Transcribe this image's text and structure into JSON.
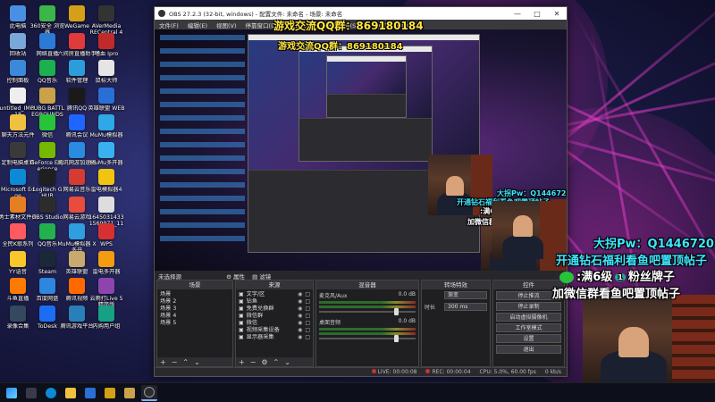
{
  "desktop": {
    "icons": [
      {
        "label": "此电脑",
        "color": "#4a90e2",
        "icon": "computer-icon"
      },
      {
        "label": "360安全\n浏览器",
        "color": "#3cb54a",
        "icon": "browser-icon"
      },
      {
        "label": "WeGame",
        "color": "#d4a017",
        "icon": "wegame-icon"
      },
      {
        "label": "AVerMedia\nRECentral 4",
        "color": "#333333",
        "icon": "avermedia-icon"
      },
      {
        "label": "回收站",
        "color": "#7aa7d9",
        "icon": "recycle-bin-icon"
      },
      {
        "label": "网络直播",
        "color": "#2b7bd6",
        "icon": "network-icon"
      },
      {
        "label": "六间房直播助手",
        "color": "#e03a3a",
        "icon": "liujianfang-icon"
      },
      {
        "label": "嗜血 Ipro",
        "color": "#c02a2a",
        "icon": "app-icon"
      },
      {
        "label": "控制面板",
        "color": "#3b8ad9",
        "icon": "control-panel-icon"
      },
      {
        "label": "QQ音乐",
        "color": "#1bb050",
        "icon": "qqmusic-icon"
      },
      {
        "label": "软件管理",
        "color": "#2d9cdb",
        "icon": "software-icon"
      },
      {
        "label": "鼠标大师",
        "color": "#e5e5e5",
        "icon": "mouse-icon"
      },
      {
        "label": "untitled_IMG.\n18",
        "color": "#eeeeee",
        "icon": "file-icon"
      },
      {
        "label": "PUBG BATTL\nEGROUNDS",
        "color": "#c9a24a",
        "icon": "pubg-icon"
      },
      {
        "label": "腾讯QQ",
        "color": "#1a1a1a",
        "icon": "qq-icon"
      },
      {
        "label": "英雄联盟 WEB",
        "color": "#2a6fd6",
        "icon": "lol-icon"
      },
      {
        "label": "聊天方法元件",
        "color": "#f0c040",
        "icon": "folder-icon"
      },
      {
        "label": "微信",
        "color": "#29c23b",
        "icon": "wechat-icon"
      },
      {
        "label": "腾讯会议",
        "color": "#1e66ff",
        "icon": "meeting-icon"
      },
      {
        "label": "MuMu模拟器",
        "color": "#2fa8e8",
        "icon": "mumu-icon"
      },
      {
        "label": "定制电脑桌面",
        "color": "#3a3a3a",
        "icon": "desktop-icon"
      },
      {
        "label": "GeForce Exp\nerience",
        "color": "#76b900",
        "icon": "geforce-icon"
      },
      {
        "label": "腾讯网游加速器",
        "color": "#2a8be0",
        "icon": "accelerator-icon"
      },
      {
        "label": "MuMu多开器",
        "color": "#39b1ef",
        "icon": "mumu-multi-icon"
      },
      {
        "label": "Microsoft Ed\nge",
        "color": "#0c8ad6",
        "icon": "edge-icon"
      },
      {
        "label": "Logitech G\nHUB",
        "color": "#1f1f1f",
        "icon": "ghub-icon"
      },
      {
        "label": "网易云音乐",
        "color": "#d43c33",
        "icon": "netease-music-icon"
      },
      {
        "label": "雷电模拟器4",
        "color": "#f1c40f",
        "icon": "ldplayer-icon"
      },
      {
        "label": "勇士素材文件夹",
        "color": "#e67e22",
        "icon": "folder-icon"
      },
      {
        "label": "OBS Studio",
        "color": "#2c2c2c",
        "icon": "obs-icon"
      },
      {
        "label": "网易云游戏",
        "color": "#e74c3c",
        "icon": "cloud-game-icon"
      },
      {
        "label": "1645031433\n1569971_11",
        "color": "#dddddd",
        "icon": "image-file-icon"
      },
      {
        "label": "全民K歌系列",
        "color": "#ff5a5f",
        "icon": "karaoke-icon"
      },
      {
        "label": "QQ音乐",
        "color": "#22b14c",
        "icon": "qqmusic-icon"
      },
      {
        "label": "MuMu模拟器\nX 多开",
        "color": "#2f9ee0",
        "icon": "mumu-icon"
      },
      {
        "label": "WPS",
        "color": "#d63031",
        "icon": "wps-icon"
      },
      {
        "label": "YY语音",
        "color": "#f9c62b",
        "icon": "yy-icon"
      },
      {
        "label": "Steam",
        "color": "#1b2838",
        "icon": "steam-icon"
      },
      {
        "label": "英雄联盟",
        "color": "#c8aa6e",
        "icon": "lol-icon"
      },
      {
        "label": "雷电多开器",
        "color": "#f39c12",
        "icon": "ldplayer-multi-icon"
      },
      {
        "label": "斗鱼直播",
        "color": "#ff7a00",
        "icon": "douyu-icon"
      },
      {
        "label": "百度网盘",
        "color": "#2e86de",
        "icon": "baidu-netdisk-icon"
      },
      {
        "label": "腾讯视频",
        "color": "#ff6a00",
        "icon": "tencent-video-icon"
      },
      {
        "label": "云雨打Live 5\n精简版",
        "color": "#8e44ad",
        "icon": "live-icon"
      },
      {
        "label": "录像合集",
        "color": "#34495e",
        "icon": "folder-icon"
      },
      {
        "label": "ToDesk",
        "color": "#1b6ef3",
        "icon": "todesk-icon"
      },
      {
        "label": "腾讯游戏平台",
        "color": "#2980b9",
        "icon": "tgp-icon"
      },
      {
        "label": "内购用户组",
        "color": "#16a085",
        "icon": "group-icon"
      }
    ]
  },
  "obs": {
    "title": "OBS 27.2.3 (32-bit, windows) - 配置文件: 未命名 - 场景: 未命名",
    "menu": [
      "文件(F)",
      "编辑(E)",
      "视图(V)",
      "停靠窗口(D)",
      "配置文件(P)",
      "场景集合(S)",
      "工具(T)",
      "帮助(H)"
    ],
    "no_source_selected": "未选择源",
    "props_label": "属性",
    "filters_label": "滤镜",
    "docks": {
      "scenes": {
        "title": "场景",
        "items": [
          "场景",
          "场景 2",
          "场景 3",
          "场景 4",
          "场景 5"
        ]
      },
      "sources": {
        "title": "来源",
        "items": [
          "文字/区",
          "钻鱼",
          "免费兑换群",
          "微信群",
          "微信",
          "视频采集设备",
          "显示器采集"
        ]
      },
      "mixer": {
        "title": "混音器",
        "channels": [
          {
            "name": "麦克风/Aux",
            "level": "0.0 dB"
          },
          {
            "name": "桌面音频",
            "level": "0.0 dB"
          }
        ]
      },
      "transitions": {
        "title": "转场特效",
        "type_label": "",
        "type_value": "渐变",
        "duration_label": "时长",
        "duration_value": "300 ms"
      },
      "controls": {
        "title": "控件",
        "buttons": [
          "停止推流",
          "停止录制",
          "启动虚拟摄像机",
          "工作室模式",
          "设置",
          "退出"
        ]
      }
    },
    "statusbar": {
      "live": "LIVE: 00:00:08",
      "rec": "REC: 00:00:04",
      "cpu": "CPU: 5.0%, 60.00 fps",
      "kbps": "0 kb/s"
    }
  },
  "overlays": {
    "qq_group_top": "游戏交流QQ群：869180184",
    "qq_group_inner": "游戏交流QQ群：869180184",
    "big_guy_pw": "大拐Pw：Q1446720",
    "diamond_welfare": "开通钻石福利看鱼吧置顶帖子",
    "fan_badge": ":满6级",
    "fan_badge_tail": "粉丝牌子",
    "wechat_group": "加微信群看鱼吧置顶帖子",
    "badge_num": "1"
  },
  "colors": {
    "accent_yellow": "#ffe640",
    "accent_cyan": "#3fe6ff",
    "accent_pink": "#ff7ad9"
  }
}
